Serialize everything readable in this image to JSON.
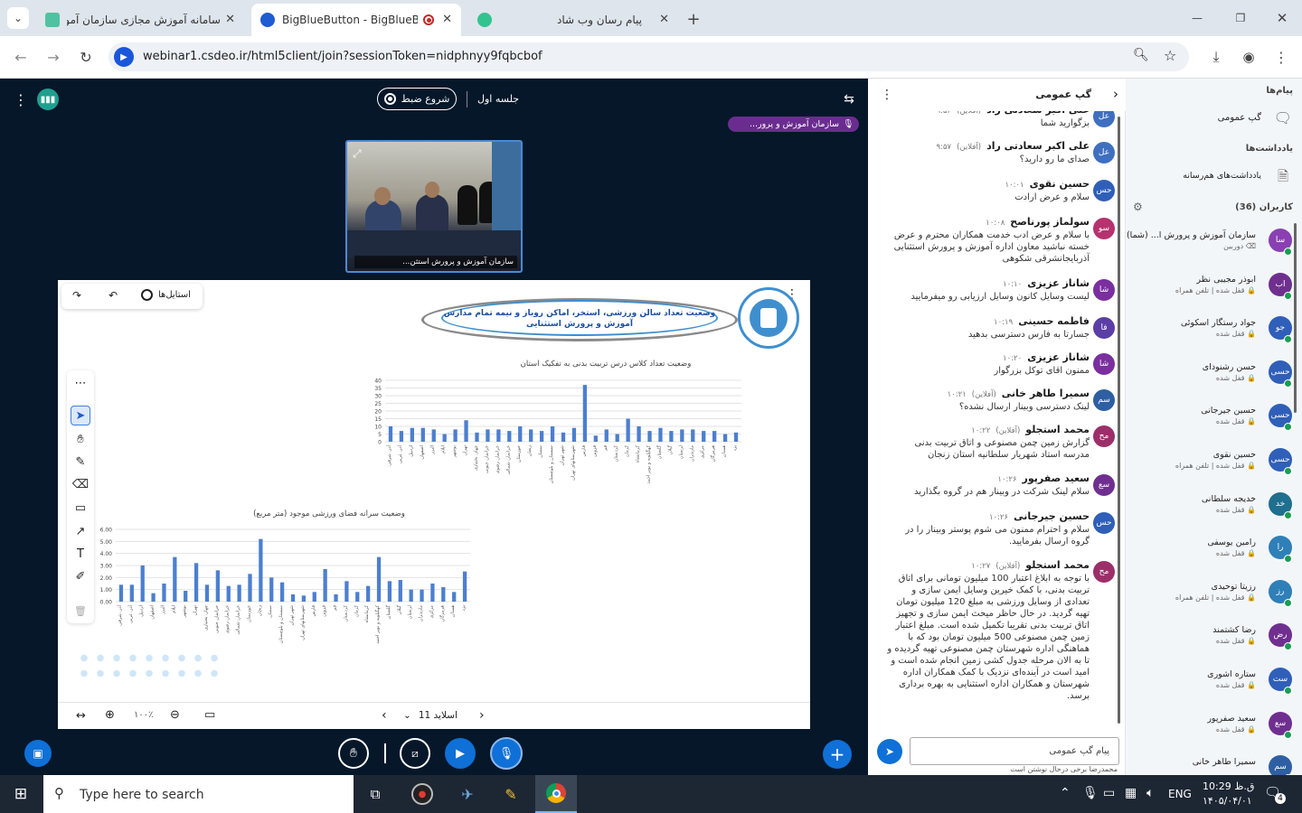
{
  "browser": {
    "tabs": [
      {
        "title": "سامانه آموزش مجازی سازمان آمو"
      },
      {
        "title": "BigBlueButton - جلسه اول"
      },
      {
        "title": ""
      },
      {
        "title": "پیام رسان وب شاد"
      }
    ],
    "url": "webinar1.csdeo.ir/html5client/join?sessionToken=nidphnyy9fqbcbof"
  },
  "meeting": {
    "record_label": "شروع ضبط",
    "title": "جلسه اول",
    "presenter_tag": "سازمان آموزش و پرور...",
    "webcam_name": "سازمان آموزش و پرورش استثن...",
    "styles_label": "استایل‌ها",
    "slide_title_line1": "وضعیت تعداد سالن ورزشی، استخر، اماکن روباز و نیمه تمام مدارس",
    "slide_title_line2": "آموزش و پرورش استثنایی",
    "slide_label": "اسلاید 11",
    "zoom": "۱۰۰٪"
  },
  "chart_data": [
    {
      "type": "bar",
      "title": "وضعیت تعداد کلاس درس تربیت بدنی به تفکیک استان",
      "ylim": [
        0,
        40
      ],
      "yticks": [
        "40",
        "35",
        "30",
        "25",
        "20",
        "15",
        "10",
        "5",
        "0"
      ],
      "categories": [
        "آذر. شرقی",
        "آذر. غربی",
        "اردبیل",
        "اصفهان",
        "البرز",
        "ایلام",
        "بوشهر",
        "تهران",
        "چهار. بختیاری",
        "خراسان جنوبی",
        "خراسان رضوی",
        "خراسان شمالی",
        "خوزستان",
        "زنجان",
        "سمنان",
        "سیستان و بلوچستان",
        "شهر تهران",
        "شهرستانهای تهران",
        "فارس",
        "قزوین",
        "قم",
        "کردستان",
        "کرمان",
        "کرمانشاه",
        "کهگیلویه و بویر احمد",
        "گلستان",
        "گیلان",
        "لرستان",
        "مازندران",
        "مرکزی",
        "هرمزگان",
        "همدان",
        "یزد"
      ],
      "values": [
        10,
        7,
        9,
        9,
        8,
        5,
        8,
        14,
        6,
        8,
        8,
        7,
        10,
        8,
        7,
        10,
        6,
        9,
        37,
        4,
        8,
        5,
        15,
        10,
        7,
        9,
        7,
        8,
        8,
        7,
        7,
        5,
        6
      ]
    },
    {
      "type": "bar",
      "title": "وضعیت سرانه فضای ورزشی موجود (متر مربع)",
      "ylim": [
        0,
        6
      ],
      "yticks": [
        "6.00",
        "5.00",
        "4.00",
        "3.00",
        "2.00",
        "1.00",
        "0.00"
      ],
      "categories": [
        "آذر. شرقی",
        "آذر. غربی",
        "اردبیل",
        "اصفهان",
        "البرز",
        "ایلام",
        "بوشهر",
        "تهران",
        "چهار. بختیاری",
        "خراسان جنوبی",
        "خراسان رضوی",
        "خراسان شمالی",
        "خوزستان",
        "زنجان",
        "سمنان",
        "سیستان و بلوچستان",
        "شهر تهران",
        "شهرستانهای تهران",
        "فارس",
        "قزوین",
        "قم",
        "کردستان",
        "کرمان",
        "کرمانشاه",
        "کهگیلویه و بویر احمد",
        "گلستان",
        "گیلان",
        "لرستان",
        "مازندران",
        "مرکزی",
        "هرمزگان",
        "همدان",
        "یزد"
      ],
      "values": [
        1.4,
        1.4,
        3.0,
        0.7,
        1.5,
        3.7,
        0.9,
        3.2,
        1.4,
        2.6,
        1.3,
        1.4,
        2.3,
        5.2,
        2.0,
        1.6,
        0.6,
        0.5,
        0.8,
        2.7,
        0.6,
        1.7,
        0.8,
        1.3,
        3.7,
        1.7,
        1.8,
        1.0,
        1.0,
        1.5,
        1.2,
        0.8,
        2.5
      ]
    }
  ],
  "chat": {
    "title": "گپ عمومی",
    "messages": [
      {
        "initials": "عل",
        "color": "#3f6fbf",
        "name": "علی اکبر سعادتی راد",
        "status": "(آفلاین)",
        "time": "۹:۵۶",
        "text": "بزگوارید شما"
      },
      {
        "initials": "عل",
        "color": "#3f6fbf",
        "name": "علی اکبر سعادتی راد",
        "status": "(آفلاین)",
        "time": "۹:۵۷",
        "text": "صدای ما رو دارید؟"
      },
      {
        "initials": "حس",
        "color": "#2f5fb8",
        "name": "حسین نقوی",
        "status": "",
        "time": "۱۰:۰۱",
        "text": "سلام و عرض ارادت"
      },
      {
        "initials": "سو",
        "color": "#b5326e",
        "name": "سولماز پورناصح",
        "status": "",
        "time": "۱۰:۰۸",
        "text": "با سلام و عرض ادب خدمت همکاران محترم و عرض خسته نباشید معاون اداره آموزش و پرورش استثنایی آذربایجانشرقی شکوهی"
      },
      {
        "initials": "شا",
        "color": "#7a2f9f",
        "name": "شاناز عزیزی",
        "status": "",
        "time": "۱۰:۱۰",
        "text": "لیست وسایل کانون وسایل ارزیابی رو میفرمایید"
      },
      {
        "initials": "فا",
        "color": "#5b3fa6",
        "name": "فاطمه حسینی",
        "status": "",
        "time": "۱۰:۱۹",
        "text": "جسارتا به فارس دسترسی بدهید"
      },
      {
        "initials": "شا",
        "color": "#7a2f9f",
        "name": "شاناز عزیزی",
        "status": "",
        "time": "۱۰:۲۰",
        "text": "ممنون اقای توکل بزرگوار"
      },
      {
        "initials": "سم",
        "color": "#2e5fa3",
        "name": "سمیرا طاهر خانی",
        "status": "(آفلاین)",
        "time": "۱۰:۲۱",
        "text": "لینک دسترسی وبینار ارسال نشده؟"
      },
      {
        "initials": "مح",
        "color": "#9c2f6a",
        "name": "محمد استجلو",
        "status": "(آفلاین)",
        "time": "۱۰:۲۲",
        "text": "گزارش زمین چمن مصنوعی و اتاق تربیت بدنی مدرسه استاد شهریار سلطانیه استان زنجان"
      },
      {
        "initials": "سع",
        "color": "#6f2f8f",
        "name": "سعید صفرپور",
        "status": "",
        "time": "۱۰:۲۶",
        "text": "سلام لینک شرکت در وبینار هم در گروه بگذارید"
      },
      {
        "initials": "حس",
        "color": "#2f5fb8",
        "name": "حسین جیرجانی",
        "status": "",
        "time": "۱۰:۲۶",
        "text": "سلام و احترام ممنون می شوم پوستر وبینار را در گروه ارسال بفرمایید."
      },
      {
        "initials": "مح",
        "color": "#9c2f6a",
        "name": "محمد استجلو",
        "status": "(آفلاین)",
        "time": "۱۰:۲۷",
        "text": "با توجه به ابلاغ اعتبار 100 میلیون تومانی برای اتاق تربیت بدنی، با کمک خیرین وسایل ایمن سازی و تعدادی از وسایل ورزشی به مبلغ 120 میلیون تومان تهیه گردید. در حال حاظر میحث ایمن سازی و تجهیز اتاق تربیت بدنی تقریبا تکمیل شده است. مبلغ اعتبار زمین چمن مصنوعی 500 میلیون تومان بود که با هماهنگی اداره شهرستان چمن مصنوعی تهیه گردیده و تا به الان مرحله جدول کشی زمین انجام شده است و امید است در آینده‌ای نزدیک با کمک همکاران اداره شهرستان و همکاران اداره استثنایی به بهره برداری برسد."
      }
    ],
    "input_placeholder": "پیام گپ عمومی",
    "typing": "محمدرضا برخی درحال نوشتن است"
  },
  "sidebar": {
    "messages_heading": "پیام‌ها",
    "public_chat": "گپ عمومی",
    "notes_heading": "یادداشت‌ها",
    "shared_notes": "یادداشت‌های هم‌رسانه",
    "users_heading": "کاربران (36)",
    "users": [
      {
        "initials": "سا",
        "color": "#8a3fb3",
        "name": "سازمان آموزش و پرورش ا... (شما)",
        "sub": "⌫ دوربین"
      },
      {
        "initials": "اب",
        "color": "#6f2f8f",
        "name": "ابوذر مجیبی نظر",
        "sub": "🔒 قفل شده | تلفن همراه"
      },
      {
        "initials": "جو",
        "color": "#2f5fb8",
        "name": "جواد رستگار اسکوئی",
        "sub": "🔒 قفل شده"
      },
      {
        "initials": "حسی",
        "color": "#2f5fb8",
        "name": "حسن رشنودای",
        "sub": "🔒 قفل شده"
      },
      {
        "initials": "حسی",
        "color": "#2f5fb8",
        "name": "حسین جیرجانی",
        "sub": "🔒 قفل شده"
      },
      {
        "initials": "حسی",
        "color": "#2f5fb8",
        "name": "حسین نقوی",
        "sub": "🔒 قفل شده | تلفن همراه"
      },
      {
        "initials": "خد",
        "color": "#1f6f8f",
        "name": "خدیجه سلطانی",
        "sub": "🔒 قفل شده"
      },
      {
        "initials": "را",
        "color": "#2f7fb8",
        "name": "رامین یوسفی",
        "sub": "🔒 قفل شده"
      },
      {
        "initials": "رز",
        "color": "#2f7fb8",
        "name": "رزیتا توحیدی",
        "sub": "🔒 قفل شده | تلفن همراه"
      },
      {
        "initials": "رض",
        "color": "#6f2f8f",
        "name": "رضا کشتمند",
        "sub": "🔒 قفل شده"
      },
      {
        "initials": "ست",
        "color": "#2f5fb8",
        "name": "ستاره اشوری",
        "sub": "🔒 قفل شده"
      },
      {
        "initials": "سع",
        "color": "#6f2f8f",
        "name": "سعید صفرپور",
        "sub": "🔒 قفل شده"
      },
      {
        "initials": "سم",
        "color": "#2e5fa3",
        "name": "سمیرا طاهر خانی",
        "sub": ""
      }
    ]
  },
  "taskbar": {
    "search_placeholder": "Type here to search",
    "lang": "ENG",
    "time": "ق.ظ 10:29",
    "date": "۱۴۰۵/۰۴/۰۱",
    "notif_count": "4"
  },
  "colors": {
    "bbb_blue": "#0f70d7",
    "stage_bg": "#06172a",
    "chart_bar": "#4c7fcf"
  }
}
